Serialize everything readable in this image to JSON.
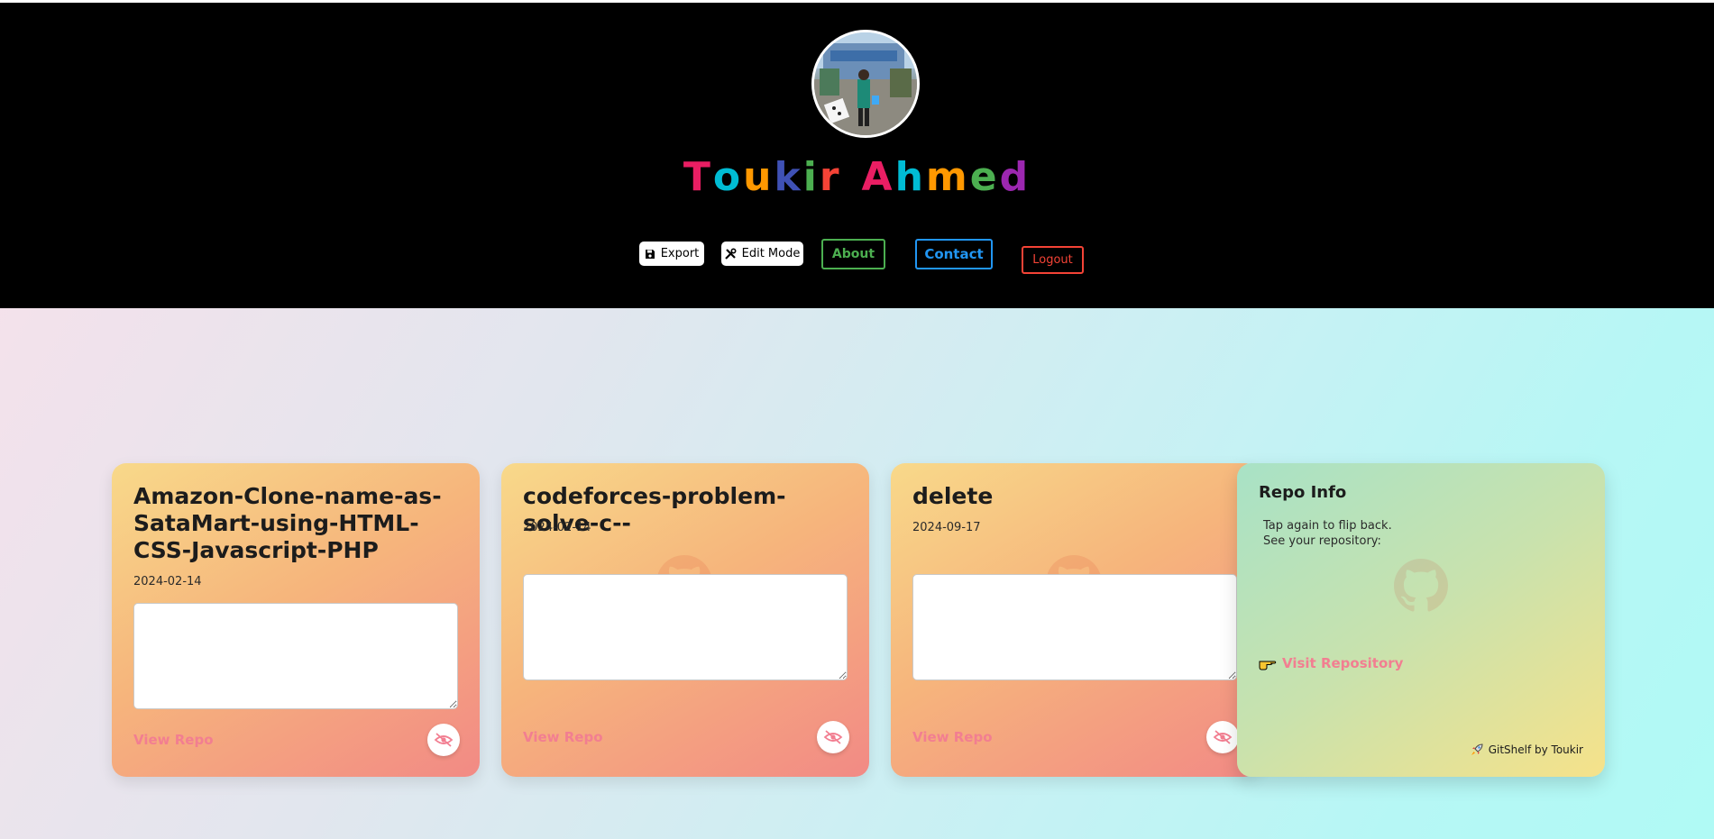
{
  "profile": {
    "name_letters": [
      "T",
      "o",
      "u",
      "k",
      "i",
      "r",
      " ",
      "A",
      "h",
      "m",
      "e",
      "d"
    ],
    "name_colors": [
      "#e91e63",
      "#00bcd4",
      "#ff9800",
      "#3f51b5",
      "#4caf50",
      "#f44336",
      "#000000",
      "#e91e63",
      "#00bcd4",
      "#ff9800",
      "#4caf50",
      "#9c27b0"
    ]
  },
  "toolbar": {
    "export_label": "Export",
    "edit_label": "Edit Mode",
    "about_label": "About",
    "contact_label": "Contact",
    "logout_label": "Logout"
  },
  "colors": {
    "about": "#4caf50",
    "contact": "#2196f3",
    "logout": "#f44336",
    "link": "#f27e91"
  },
  "repos": [
    {
      "name": "Amazon-Clone-name-as-SataMart-using-HTML-CSS-Javascript-PHP",
      "date": "2024-02-14",
      "notes": "",
      "view_label": "View Repo",
      "visibility_icon": "eye-slash-icon"
    },
    {
      "name": "codeforces-problem-solve-c--",
      "date": "2024-02-14",
      "notes": "",
      "view_label": "View Repo",
      "visibility_icon": "eye-slash-icon"
    },
    {
      "name": "delete",
      "date": "2024-09-17",
      "notes": "",
      "view_label": "View Repo",
      "visibility_icon": "eye-slash-icon"
    }
  ],
  "flipped": {
    "title": "Repo Info",
    "line1": "Tap again to flip back.",
    "line2": "See your repository:",
    "visit_label": "Visit Repository",
    "credit": "GitShelf by Toukir"
  }
}
